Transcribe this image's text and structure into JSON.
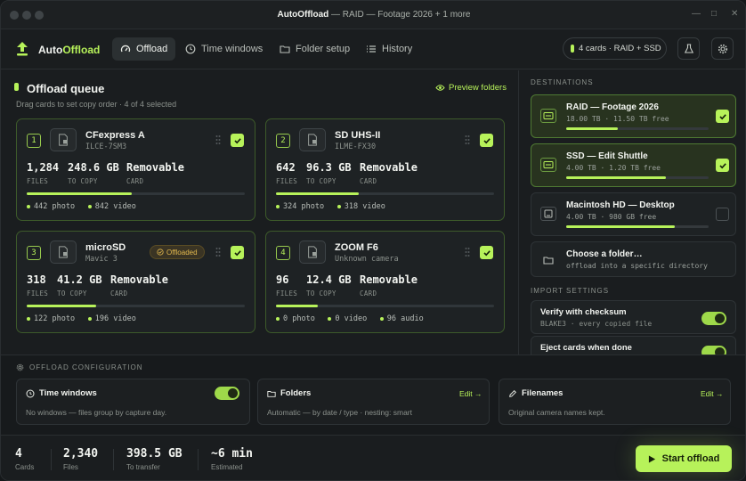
{
  "window": {
    "app": "AutoOffload",
    "title_rest": " — RAID — Footage 2026 + 1 more",
    "ctrl_min": "—",
    "ctrl_max": "□",
    "ctrl_close": "✕"
  },
  "nav": {
    "brand_a": "Auto",
    "brand_b": "Offload",
    "tabs": [
      {
        "label": "Offload",
        "icon": "gauge-icon"
      },
      {
        "label": "Time windows",
        "icon": "clock-icon"
      },
      {
        "label": "Folder setup",
        "icon": "folder-icon"
      },
      {
        "label": "History",
        "icon": "list-icon"
      }
    ],
    "status_pill": "4 cards · RAID + SSD"
  },
  "queue": {
    "title": "Offload queue",
    "subtitle": "Drag cards to set copy order · 4 of 4 selected",
    "preview": "Preview folders"
  },
  "labels": {
    "files": "FILES",
    "to_copy": "TO COPY",
    "card": "CARD"
  },
  "cards": [
    {
      "order": "1",
      "name": "CFexpress A",
      "model": "ILCE-7SM3",
      "files": "1,284",
      "size": "248.6 GB",
      "type": "Removable",
      "progress": 0.48,
      "legend": [
        "442 photo",
        "842 video"
      ],
      "selected": true
    },
    {
      "order": "2",
      "name": "SD UHS-II",
      "model": "ILME-FX30",
      "files": "642",
      "size": "96.3 GB",
      "type": "Removable",
      "progress": 0.38,
      "legend": [
        "324 photo",
        "318 video"
      ],
      "selected": true
    },
    {
      "order": "3",
      "name": "microSD",
      "model": "Mavic 3",
      "files": "318",
      "size": "41.2 GB",
      "type": "Removable",
      "progress": 0.32,
      "legend": [
        "122 photo",
        "196 video"
      ],
      "selected": true,
      "badge": "Offloaded"
    },
    {
      "order": "4",
      "name": "ZOOM F6",
      "model": "Unknown camera",
      "files": "96",
      "size": "12.4 GB",
      "type": "Removable",
      "progress": 0.19,
      "legend": [
        "0 photo",
        "0 video",
        "96 audio"
      ],
      "selected": true
    }
  ],
  "destinations": {
    "heading": "DESTINATIONS",
    "items": [
      {
        "name": "RAID — Footage 2026",
        "detail": "18.00 TB · 11.50 TB free",
        "usage": 0.36,
        "selected": true
      },
      {
        "name": "SSD — Edit Shuttle",
        "detail": "4.00 TB · 1.20 TB free",
        "usage": 0.7,
        "selected": true
      },
      {
        "name": "Macintosh HD — Desktop",
        "detail": "4.00 TB · 980 GB free",
        "usage": 0.76,
        "selected": false
      },
      {
        "name": "Choose a folder…",
        "detail": "offload into a specific directory"
      }
    ]
  },
  "import_settings": {
    "heading": "IMPORT SETTINGS",
    "items": [
      {
        "name": "Verify with checksum",
        "detail": "BLAKE3 · every copied file",
        "on": true
      },
      {
        "name": "Eject cards when done",
        "detail": "",
        "on": true
      }
    ]
  },
  "config": {
    "heading": "OFFLOAD CONFIGURATION",
    "time": {
      "title": "Time windows",
      "desc": "No windows — files group by capture day.",
      "on": true
    },
    "folders": {
      "title": "Folders",
      "desc": "Automatic — by date / type · nesting: smart",
      "edit": "Edit →"
    },
    "filenames": {
      "title": "Filenames",
      "desc": "Original camera names kept.",
      "edit": "Edit →"
    }
  },
  "footer": {
    "cards": "4",
    "cards_l": "Cards",
    "files": "2,340",
    "files_l": "Files",
    "size": "398.5 GB",
    "size_l": "To transfer",
    "time": "~6 min",
    "time_l": "Estimated",
    "start": "Start offload"
  },
  "colors": {
    "accent": "#b7f25a",
    "badge": "#e3b94e"
  }
}
